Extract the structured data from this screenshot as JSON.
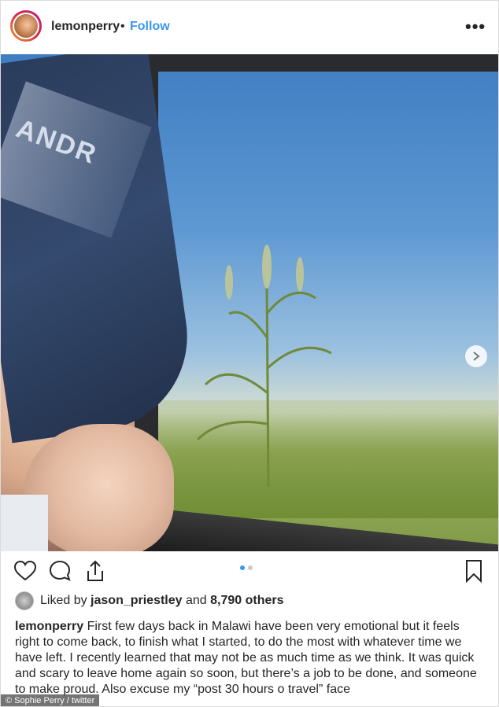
{
  "header": {
    "username": "lemonperry",
    "separator": "•",
    "follow_label": "Follow",
    "more_label": "•••"
  },
  "photo": {
    "cap_text": "ANDR",
    "next_icon": "chevron-right-icon"
  },
  "actions": {
    "icons": [
      "heart-icon",
      "comment-icon",
      "share-icon",
      "bookmark-icon"
    ],
    "pager_active_color": "#3897f0",
    "pager_inactive_color": "#c8c8c8"
  },
  "likes": {
    "prefix": "Liked by",
    "user": "jason_priestley",
    "middle": "and",
    "others": "8,790 others"
  },
  "caption": {
    "username": "lemonperry",
    "text": "First few days back in Malawi have been very emotional but it feels right to come back, to finish what I started, to do the most with whatever time we have left. I recently learned that may not be as much time as we think. It was quick and scary to leave home again so soon, but there’s a job to be done, and someone to make proud. Also excuse my “post 30 hours o travel” face"
  },
  "credit": "© Sophie Perry / twitter",
  "colors": {
    "link": "#3897f0",
    "text": "#262626",
    "border": "#dbdbdb"
  }
}
